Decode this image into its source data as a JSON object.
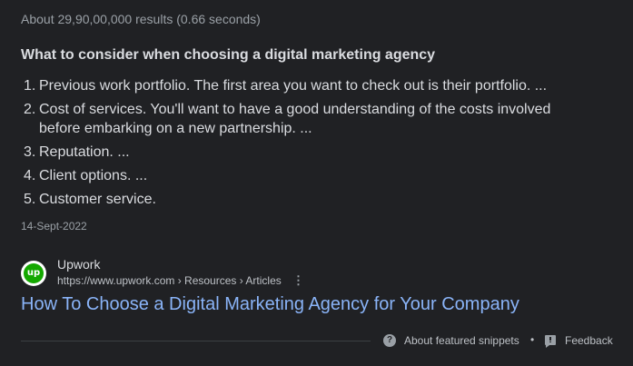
{
  "stats": {
    "text": "About 29,90,00,000 results (0.66 seconds)"
  },
  "snippet": {
    "heading": "What to consider when choosing a digital marketing agency",
    "items": [
      {
        "num": "1.",
        "text": "Previous work portfolio. The first area you want to check out is their portfolio. ..."
      },
      {
        "num": "2.",
        "text": "Cost of services. You'll want to have a good understanding of the costs involved before embarking on a new partnership. ..."
      },
      {
        "num": "3.",
        "text": "Reputation. ..."
      },
      {
        "num": "4.",
        "text": "Client options. ..."
      },
      {
        "num": "5.",
        "text": "Customer service."
      }
    ],
    "date": "14-Sept-2022"
  },
  "source": {
    "favicon_text": "up",
    "favicon_icon": "upwork-logo-icon",
    "site_name": "Upwork",
    "url": "https://www.upwork.com › Resources › Articles",
    "more_icon": "more-vert-icon"
  },
  "result": {
    "title": "How To Choose a Digital Marketing Agency for Your Company"
  },
  "footer": {
    "about_label": "About featured snippets",
    "separator": "•",
    "feedback_label": "Feedback",
    "help_icon": "help-circle-icon",
    "feedback_icon": "feedback-icon"
  },
  "colors": {
    "background": "#202124",
    "link": "#8ab4f8",
    "text": "#dadce0",
    "muted": "#9aa0a6",
    "upwork_green": "#14a800"
  }
}
